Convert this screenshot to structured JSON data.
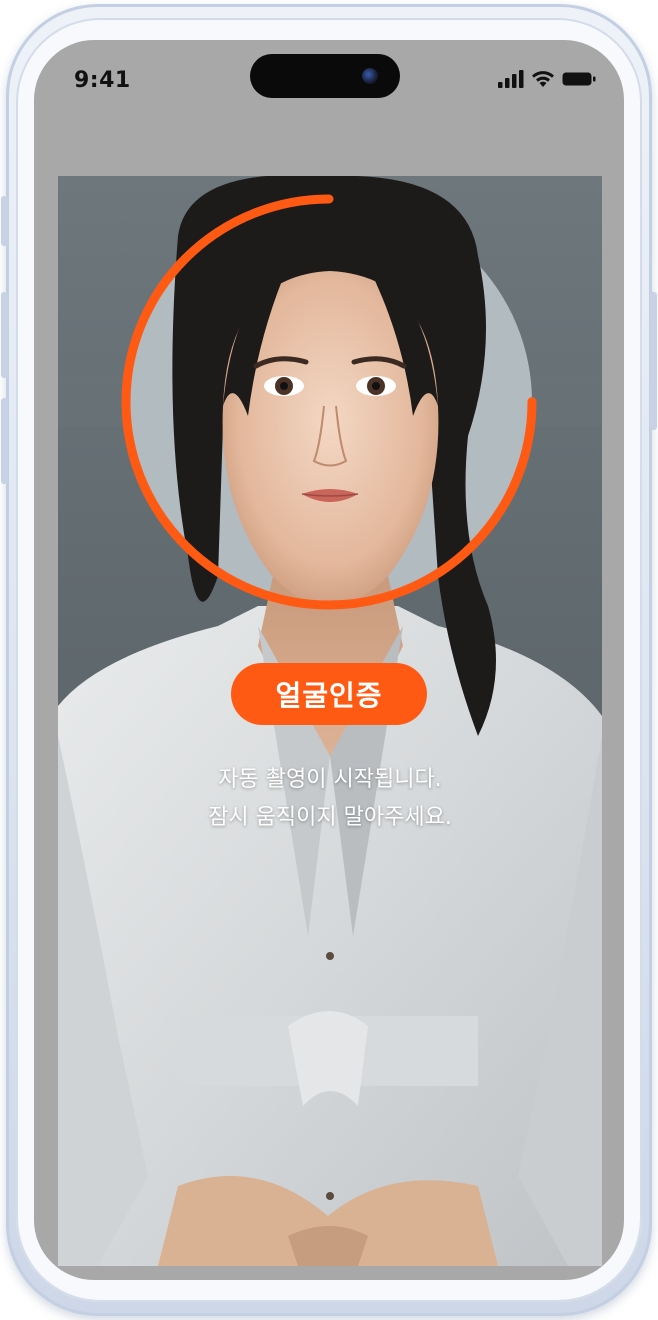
{
  "status_bar": {
    "time": "9:41",
    "signal_icon": "signal-bars-icon",
    "wifi_icon": "wifi-icon",
    "battery_icon": "battery-icon"
  },
  "face_auth": {
    "badge_label": "얼굴인증",
    "instruction_line1": "자동 촬영이 시작됩니다.",
    "instruction_line2": "잠시 움직이지 말아주세요.",
    "capture_progress": 0.75
  },
  "colors": {
    "accent": "#ff5a14",
    "screen_bg": "#a8a8a8",
    "frame": "#dfe6f1"
  }
}
